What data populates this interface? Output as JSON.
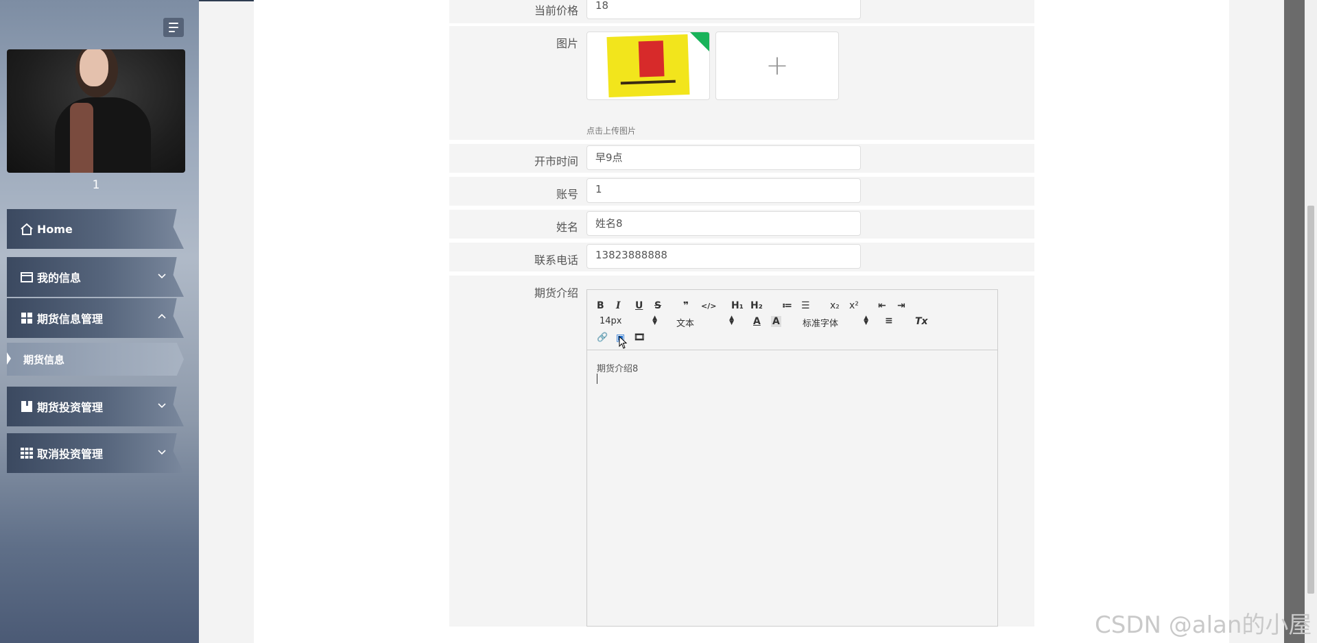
{
  "sidebar": {
    "username": "1",
    "menu": [
      {
        "label": "Home",
        "icon": "home-icon"
      },
      {
        "label": "我的信息",
        "icon": "card-icon"
      },
      {
        "label": "期货信息管理",
        "icon": "grid-icon"
      },
      {
        "label": "期货投资管理",
        "icon": "book-icon"
      },
      {
        "label": "取消投资管理",
        "icon": "apps-icon"
      }
    ],
    "submenu": {
      "label": "期货信息"
    }
  },
  "form": {
    "price": {
      "label": "当前价格",
      "value": "18"
    },
    "image": {
      "label": "图片",
      "hint": "点击上传图片",
      "upload_plus": "+"
    },
    "open_time": {
      "label": "开市时间",
      "value": "早9点"
    },
    "account": {
      "label": "账号",
      "value": "1"
    },
    "name": {
      "label": "姓名",
      "value": "姓名8"
    },
    "phone": {
      "label": "联系电话",
      "value": "13823888888"
    },
    "intro": {
      "label": "期货介绍",
      "content": "期货介绍8"
    }
  },
  "editor_toolbar": {
    "bold": "B",
    "italic": "I",
    "underline": "U",
    "strike": "S",
    "quote": "❞",
    "code": "</>",
    "h1": "H₁",
    "h2": "H₂",
    "ordered": "≔",
    "bullet": "☰",
    "sub": "x₂",
    "sup": "x²",
    "outdent": "⇤",
    "indent": "⇥",
    "font_size": "14px",
    "text_type": "文本",
    "text_color": "A",
    "bg_color": "A",
    "font_family": "标准字体",
    "align": "≡",
    "clear": "Tx",
    "link": "🔗",
    "image": "▣",
    "video": "🎞"
  },
  "watermark": "CSDN @alan的小屋",
  "colors": {
    "accent_green": "#19b35a",
    "sidebar_dark": "#3b4960"
  }
}
